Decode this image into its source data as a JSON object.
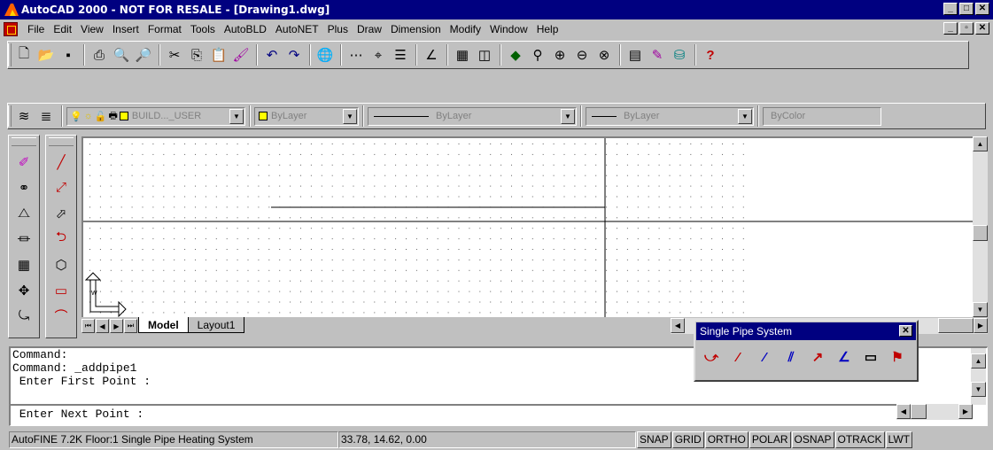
{
  "window": {
    "title": "AutoCAD 2000 - NOT FOR RESALE - [Drawing1.dwg]"
  },
  "menu": [
    "File",
    "Edit",
    "View",
    "Insert",
    "Format",
    "Tools",
    "AutoBLD",
    "AutoNET",
    "Plus",
    "Draw",
    "Dimension",
    "Modify",
    "Window",
    "Help"
  ],
  "standard_toolbar": {
    "buttons": [
      "new-icon",
      "open-icon",
      "save-icon",
      "print-icon",
      "print-preview-icon",
      "find-replace-icon",
      "cut-icon",
      "copy-icon",
      "paste-icon",
      "match-properties-icon",
      "undo-icon",
      "redo-icon",
      "hyperlink-icon",
      "tracking-icon",
      "object-snap-icon",
      "ucs-icon",
      "distance-icon",
      "named-views-icon",
      "3d-orbit-icon",
      "pan-icon",
      "zoom-realtime-icon",
      "zoom-window-icon",
      "zoom-previous-icon",
      "properties-icon",
      "design-center-icon",
      "dbconnect-icon",
      "help-icon"
    ]
  },
  "properties_toolbar": {
    "layer": "BUILD..._USER",
    "color": "ByLayer",
    "linetype": "ByLayer",
    "lineweight": "ByLayer",
    "plotstyle": "ByColor"
  },
  "tabs": [
    {
      "label": "Model",
      "active": true
    },
    {
      "label": "Layout1",
      "active": false
    }
  ],
  "floating_toolbar": {
    "title": "Single Pipe System",
    "tools": [
      "pipe-tool-1-icon",
      "pipe-tool-2-icon",
      "pipe-tool-3-icon",
      "pipe-tool-4-icon",
      "pipe-tool-5-icon",
      "pipe-tool-6-icon",
      "pipe-tool-7-icon"
    ]
  },
  "command_window": {
    "lines": [
      "Command:",
      "Command: _addpipe1",
      " Enter First Point :"
    ],
    "prompt": " Enter Next Point :"
  },
  "status_bar": {
    "info": "AutoFINE 7.2K Floor:1 Single Pipe Heating System",
    "coords": "33.78, 14.62, 0.00",
    "toggles": [
      "SNAP",
      "GRID",
      "ORTHO",
      "POLAR",
      "OSNAP",
      "OTRACK",
      "LWT"
    ]
  },
  "colors": {
    "titlebar": "#000080",
    "face": "#c0c0c0",
    "drawing_bg": "#ffffff"
  }
}
